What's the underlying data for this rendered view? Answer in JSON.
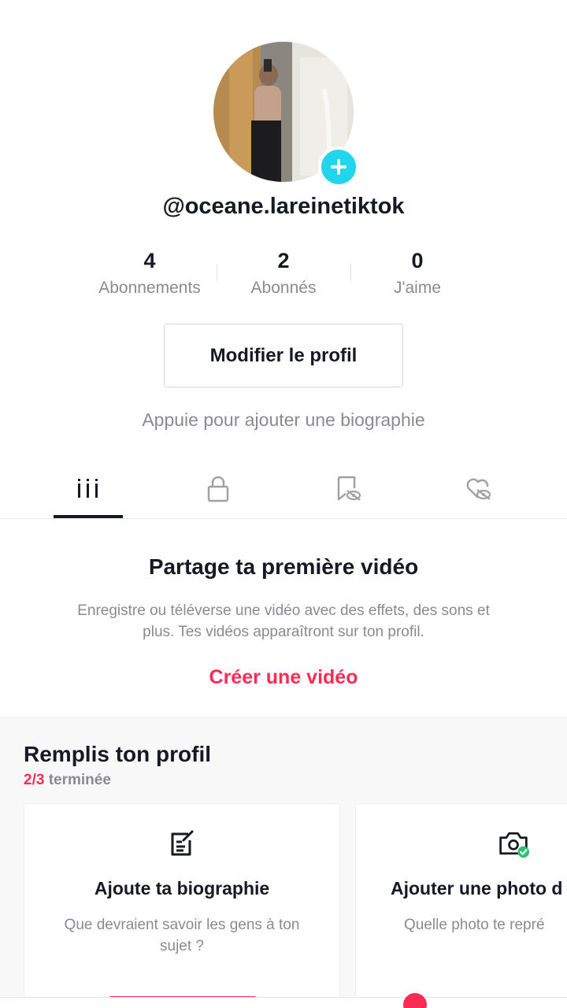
{
  "profile": {
    "username": "@oceane.lareinetiktok",
    "stats": [
      {
        "value": "4",
        "label": "Abonnements"
      },
      {
        "value": "2",
        "label": "Abonnés"
      },
      {
        "value": "0",
        "label": "J'aime"
      }
    ],
    "edit_button": "Modifier le profil",
    "bio_hint": "Appuie pour ajouter une biographie"
  },
  "tabs": [
    {
      "icon": "grid-icon",
      "active": true
    },
    {
      "icon": "lock-icon",
      "active": false
    },
    {
      "icon": "bookmark-hidden-icon",
      "active": false
    },
    {
      "icon": "heart-hidden-icon",
      "active": false
    }
  ],
  "empty_state": {
    "title": "Partage ta première vidéo",
    "description": "Enregistre ou téléverse une vidéo avec des effets, des sons et plus. Tes vidéos apparaîtront sur ton profil.",
    "cta": "Créer une vidéo"
  },
  "fill_profile": {
    "title": "Remplis ton profil",
    "progress_count": "2/3",
    "progress_label": "terminée",
    "cards": [
      {
        "icon": "edit-bio-icon",
        "title": "Ajoute ta biographie",
        "description": "Que devraient savoir les gens à ton sujet ?"
      },
      {
        "icon": "camera-check-icon",
        "title": "Ajouter une photo d",
        "description": "Quelle photo te repré"
      }
    ]
  },
  "colors": {
    "accent": "#fe2c55",
    "teal": "#20d5ec",
    "text_primary": "#161823",
    "text_secondary": "#8a8b91"
  }
}
